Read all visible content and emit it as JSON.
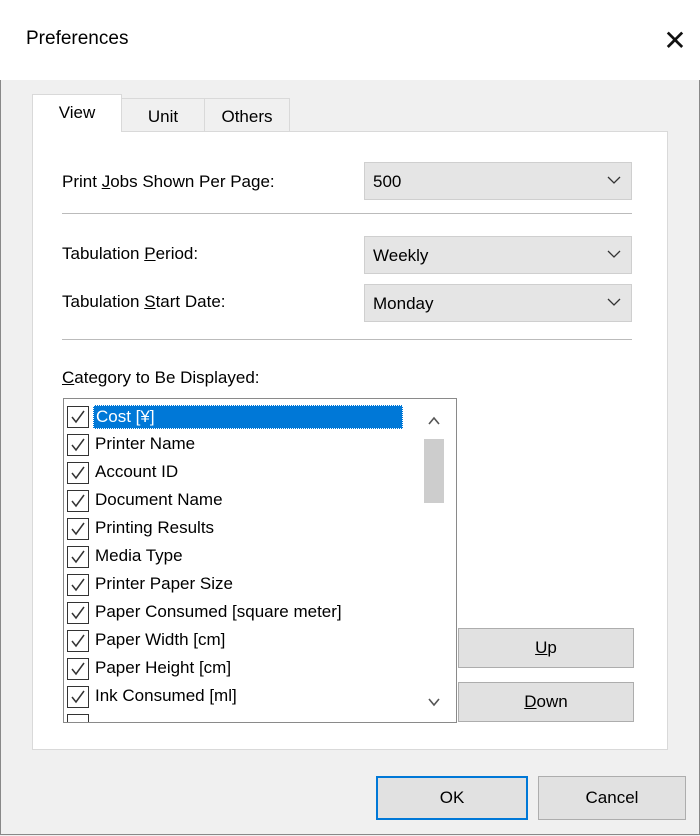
{
  "window": {
    "title": "Preferences"
  },
  "tabs": [
    {
      "label": "View",
      "active": true
    },
    {
      "label": "Unit",
      "active": false
    },
    {
      "label": "Others",
      "active": false
    }
  ],
  "fields": {
    "print_jobs": {
      "label_pre": "Print ",
      "label_key": "J",
      "label_post": "obs Shown Per Page:",
      "value": "500"
    },
    "tab_period": {
      "label_pre": "Tabulation ",
      "label_key": "P",
      "label_post": "eriod:",
      "value": "Weekly"
    },
    "tab_start": {
      "label_pre": "Tabulation ",
      "label_key": "S",
      "label_post": "tart Date:",
      "value": "Monday"
    }
  },
  "category": {
    "label_key": "C",
    "label_post": "ategory to Be Displayed:",
    "items": [
      {
        "label": "Cost [¥]",
        "checked": true,
        "selected": true
      },
      {
        "label": "Printer Name",
        "checked": true,
        "selected": false
      },
      {
        "label": "Account ID",
        "checked": true,
        "selected": false
      },
      {
        "label": "Document Name",
        "checked": true,
        "selected": false
      },
      {
        "label": "Printing Results",
        "checked": true,
        "selected": false
      },
      {
        "label": "Media Type",
        "checked": true,
        "selected": false
      },
      {
        "label": "Printer Paper Size",
        "checked": true,
        "selected": false
      },
      {
        "label": "Paper Consumed [square meter]",
        "checked": true,
        "selected": false
      },
      {
        "label": "Paper Width [cm]",
        "checked": true,
        "selected": false
      },
      {
        "label": "Paper Height [cm]",
        "checked": true,
        "selected": false
      },
      {
        "label": "Ink Consumed [ml]",
        "checked": true,
        "selected": false
      }
    ]
  },
  "buttons": {
    "up_key": "U",
    "up_post": "p",
    "down_key": "D",
    "down_post": "own",
    "ok": "OK",
    "cancel": "Cancel"
  }
}
